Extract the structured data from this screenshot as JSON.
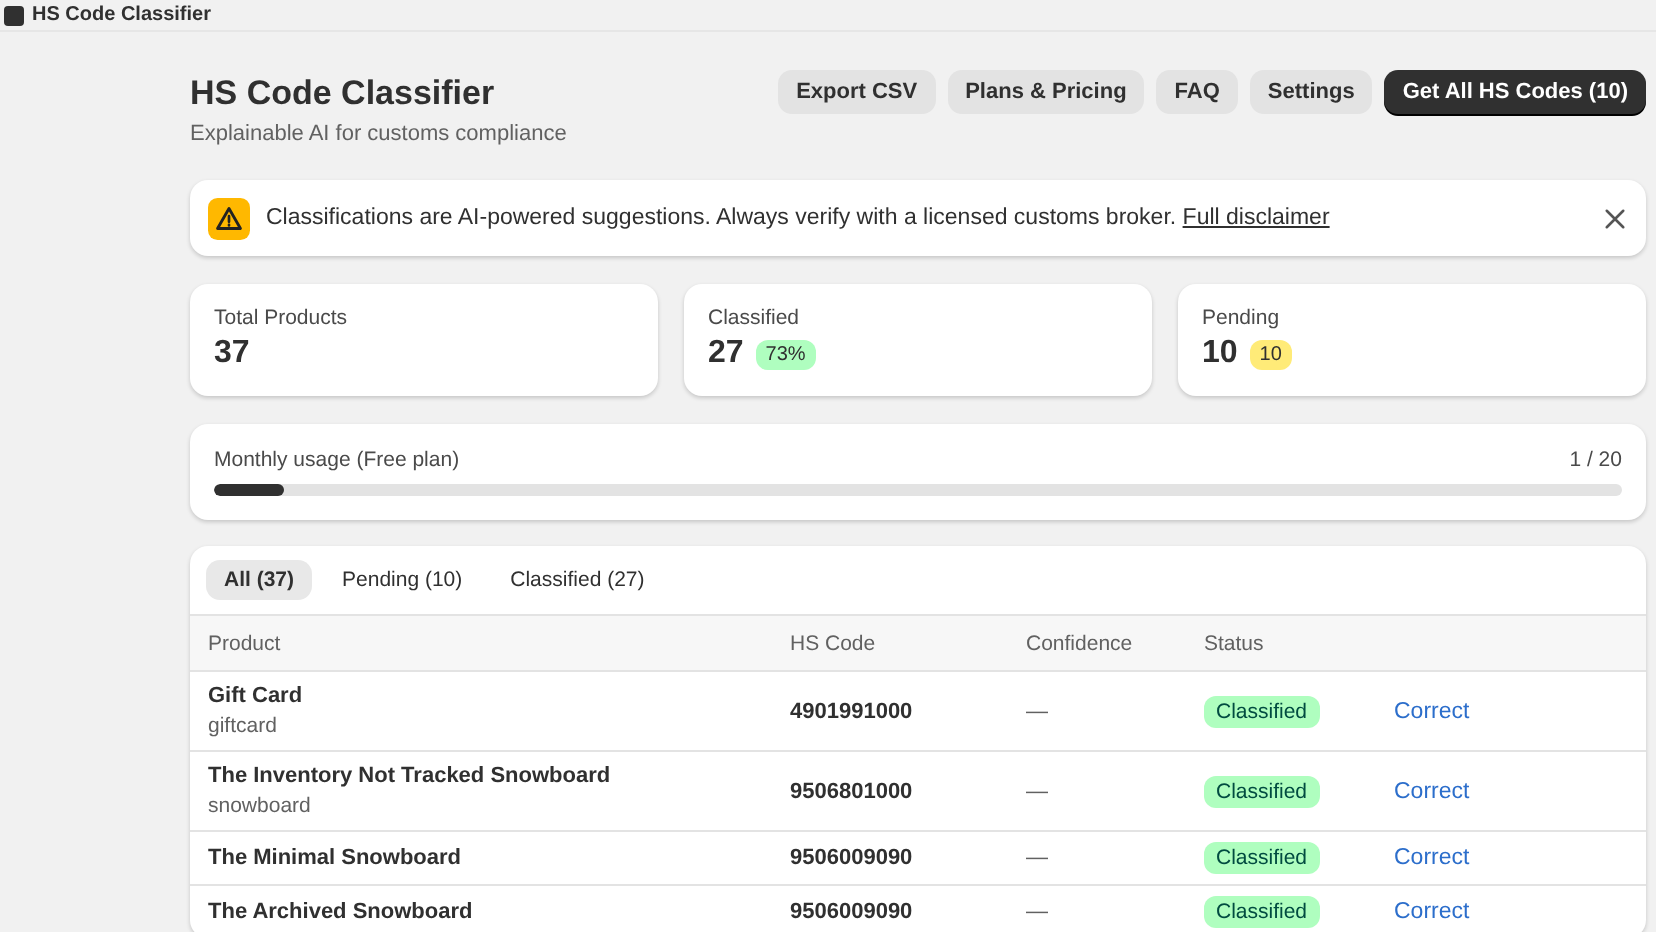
{
  "app_bar": {
    "title": "HS Code Classifier"
  },
  "header": {
    "title": "HS Code Classifier",
    "subtitle": "Explainable AI for customs compliance",
    "buttons": [
      {
        "label": "Export CSV",
        "kind": "secondary"
      },
      {
        "label": "Plans & Pricing",
        "kind": "secondary"
      },
      {
        "label": "FAQ",
        "kind": "secondary"
      },
      {
        "label": "Settings",
        "kind": "secondary"
      },
      {
        "label": "Get All HS Codes (10)",
        "kind": "primary"
      }
    ]
  },
  "alert": {
    "text": "Classifications are AI-powered suggestions. Always verify with a licensed customs broker.",
    "link": "Full disclaimer"
  },
  "stats": [
    {
      "label": "Total Products",
      "value": "37"
    },
    {
      "label": "Classified",
      "value": "27",
      "badge": "73%",
      "color": "#affebf"
    },
    {
      "label": "Pending",
      "value": "10",
      "badge": "10",
      "color": "#ffeb78"
    }
  ],
  "usage": {
    "label": "Monthly usage (Free plan)",
    "reading": "1 / 20",
    "level": 0.05
  },
  "tabs": [
    {
      "label": "All (37)",
      "selected": true
    },
    {
      "label": "Pending (10)",
      "selected": false
    },
    {
      "label": "Classified (27)",
      "selected": false
    }
  ],
  "table": {
    "columns": [
      "Product",
      "HS Code",
      "Confidence",
      "Status"
    ],
    "rows": [
      {
        "name": "Gift Card",
        "handle": "giftcard",
        "hs_code": "4901991000",
        "confidence": "—",
        "status": "Classified",
        "action": "Correct"
      },
      {
        "name": "The Inventory Not Tracked Snowboard",
        "handle": "snowboard",
        "hs_code": "9506801000",
        "confidence": "—",
        "status": "Classified",
        "action": "Correct"
      },
      {
        "name": "The Minimal Snowboard",
        "hs_code": "9506009090",
        "confidence": "—",
        "status": "Classified",
        "action": "Correct"
      },
      {
        "name": "The Archived Snowboard",
        "hs_code": "9506009090",
        "confidence": "—",
        "status": "Classified",
        "action": "Correct"
      }
    ]
  }
}
